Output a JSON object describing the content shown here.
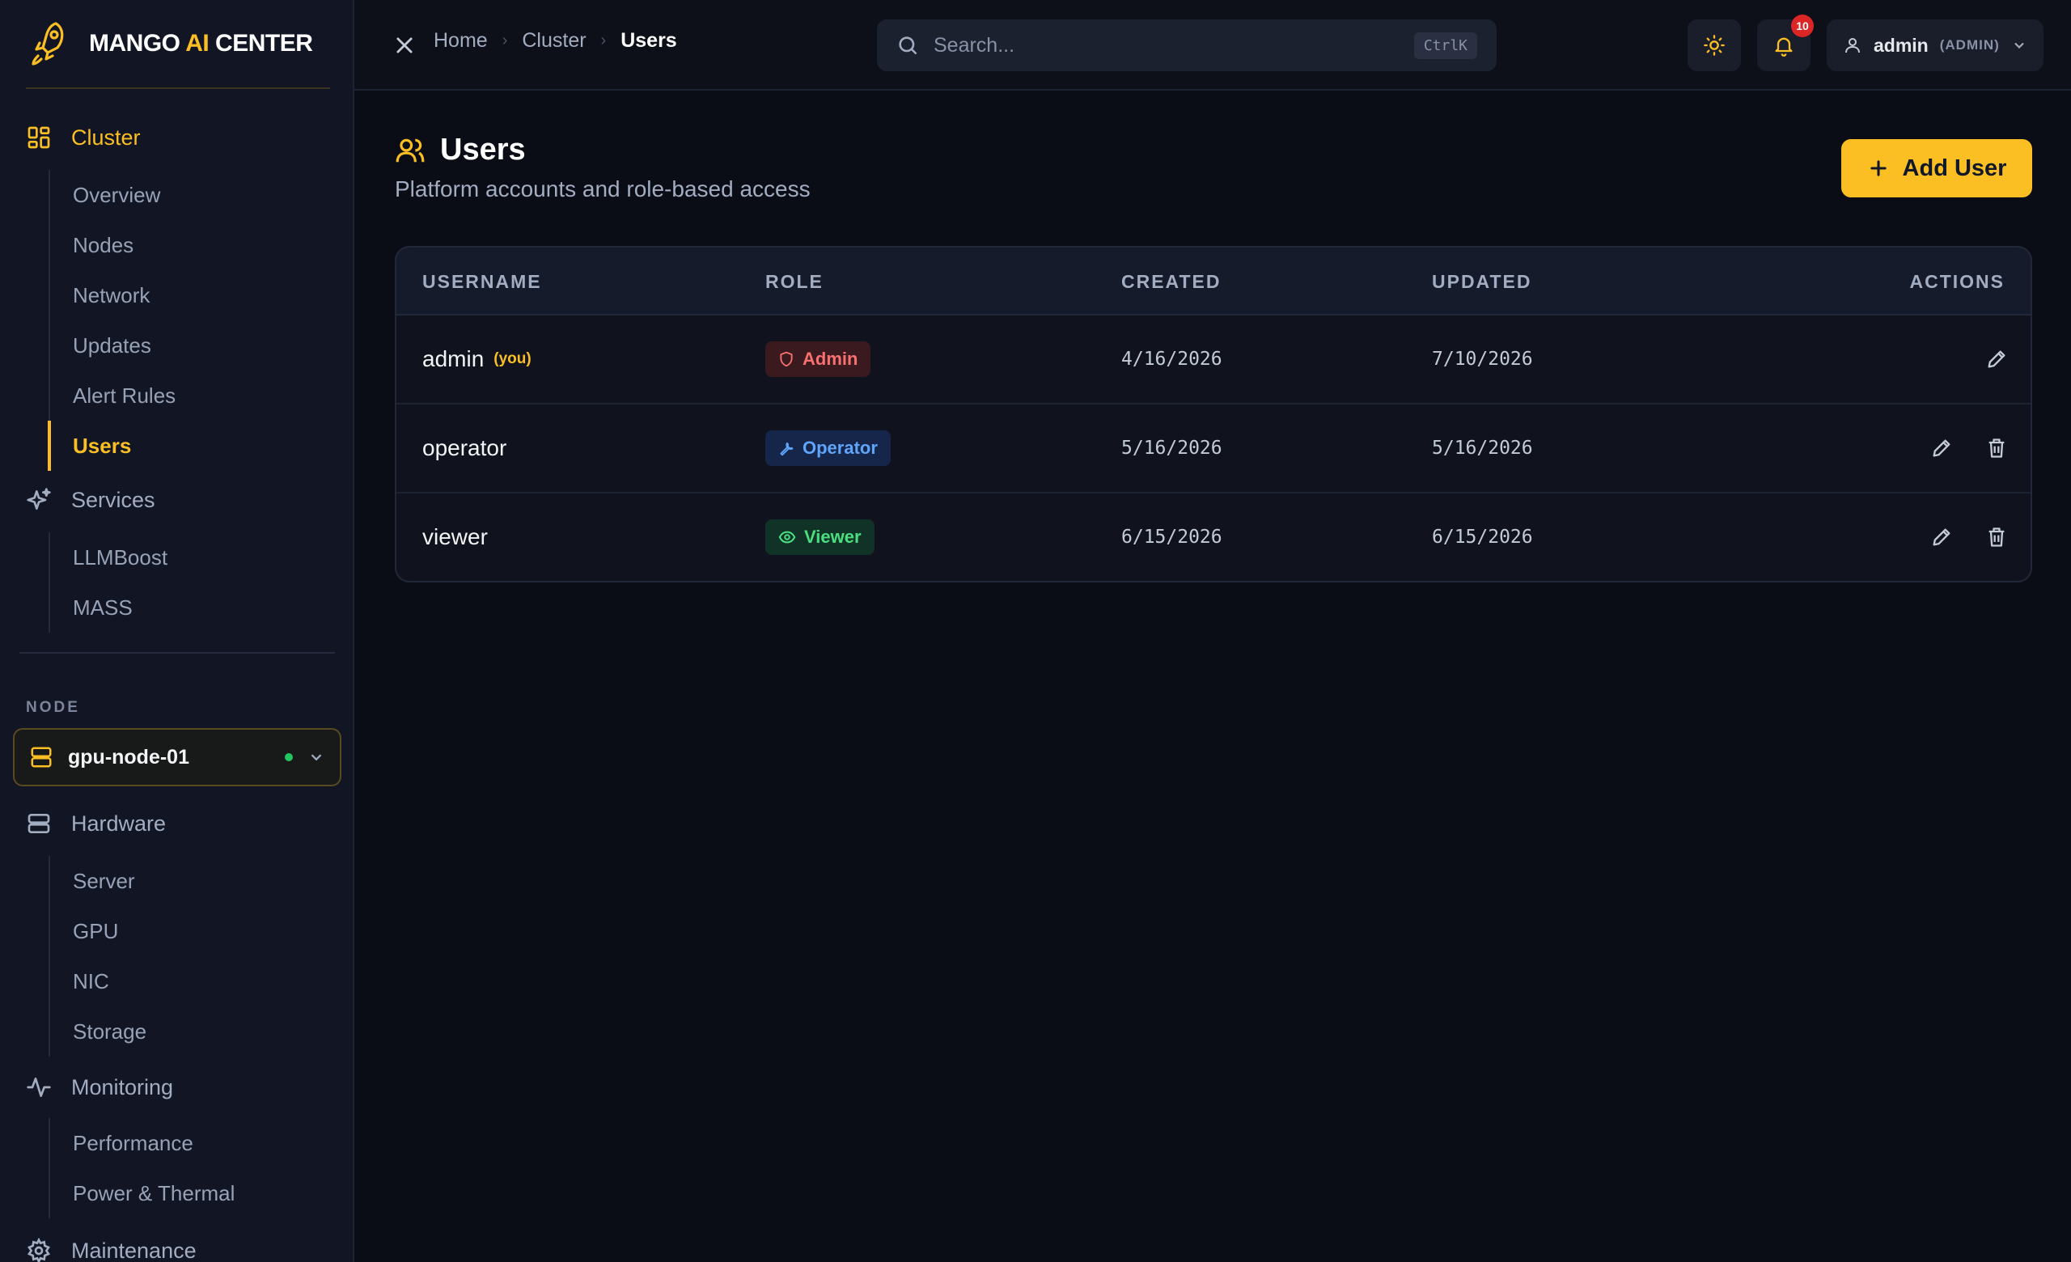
{
  "brand": {
    "name_part1": "MANGO ",
    "name_ai": "AI",
    "name_part2": " CENTER"
  },
  "sidebar": {
    "cluster": {
      "label": "Cluster",
      "items": [
        "Overview",
        "Nodes",
        "Network",
        "Updates",
        "Alert Rules",
        "Users"
      ],
      "active": "Users"
    },
    "services": {
      "label": "Services",
      "items": [
        "LLMBoost",
        "MASS"
      ]
    },
    "node_section_label": "NODE",
    "node_selector": {
      "value": "gpu-node-01",
      "status_color": "#22c55e"
    },
    "hardware": {
      "label": "Hardware",
      "items": [
        "Server",
        "GPU",
        "NIC",
        "Storage"
      ]
    },
    "monitoring": {
      "label": "Monitoring",
      "items": [
        "Performance",
        "Power & Thermal"
      ]
    },
    "maintenance": {
      "label": "Maintenance"
    }
  },
  "topbar": {
    "breadcrumb": [
      "Home",
      "Cluster",
      "Users"
    ],
    "search": {
      "placeholder": "Search...",
      "shortcut": "CtrlK"
    },
    "notifications_count": "10",
    "user": {
      "name": "admin",
      "role": "(ADMIN)"
    }
  },
  "page": {
    "title": "Users",
    "subtitle": "Platform accounts and role-based access",
    "add_button": "Add User"
  },
  "table": {
    "headers": {
      "username": "USERNAME",
      "role": "ROLE",
      "created": "CREATED",
      "updated": "UPDATED",
      "actions": "ACTIONS"
    },
    "rows": [
      {
        "username": "admin",
        "you": "(you)",
        "role": "Admin",
        "created": "4/16/2026",
        "updated": "7/10/2026"
      },
      {
        "username": "operator",
        "role": "Operator",
        "created": "5/16/2026",
        "updated": "5/16/2026"
      },
      {
        "username": "viewer",
        "role": "Viewer",
        "created": "6/15/2026",
        "updated": "6/15/2026"
      }
    ]
  },
  "colors": {
    "accent": "#fbbf24",
    "background": "#0b0d16",
    "admin": "#f87171",
    "operator": "#60a5fa",
    "viewer": "#4ade80"
  }
}
